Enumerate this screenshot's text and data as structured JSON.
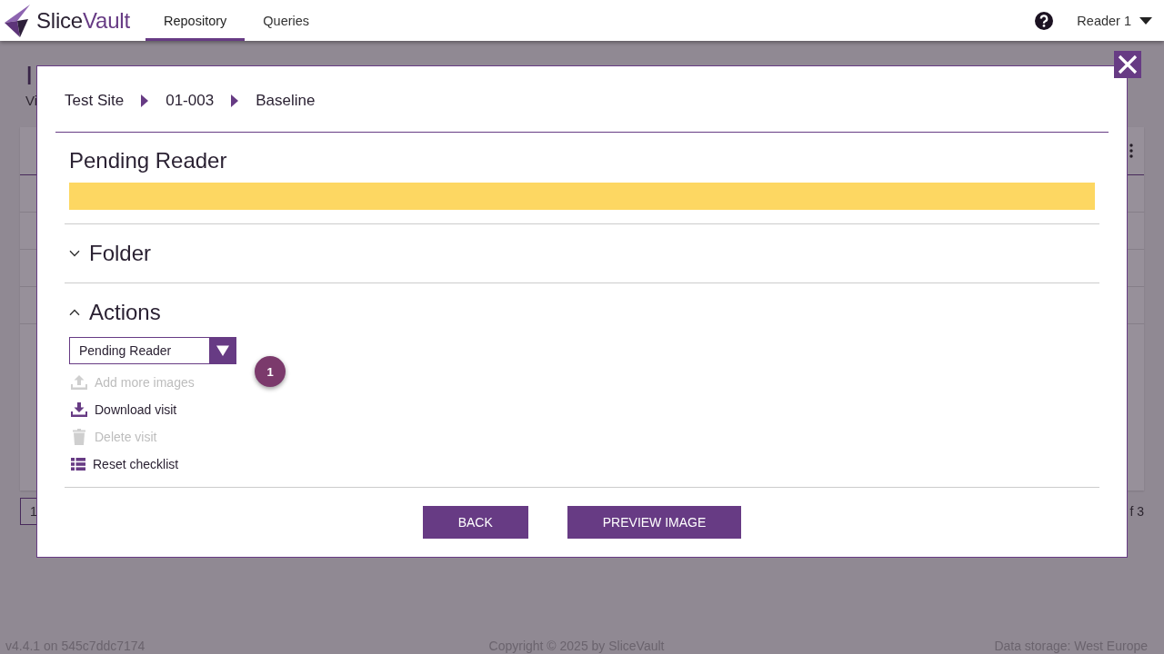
{
  "nav": {
    "logo": [
      "Slice",
      "Vault"
    ],
    "tabs": [
      {
        "label": "Repository",
        "selected": true
      },
      {
        "label": "Queries",
        "selected": false
      }
    ],
    "user": "Reader 1"
  },
  "background_page": {
    "heading": "I",
    "subtitle": "Vi",
    "page_button": "1",
    "page_count": "f 3"
  },
  "modal": {
    "breadcrumb": [
      "Test Site",
      "01-003",
      "Baseline"
    ],
    "status_title": "Pending Reader",
    "sections": [
      {
        "title": "Folder",
        "expanded": false
      },
      {
        "title": "Actions",
        "expanded": true,
        "select": {
          "value": "Pending Reader"
        },
        "badge": "1",
        "items": [
          {
            "label": "Add more images",
            "kind": "upload",
            "disabled": true
          },
          {
            "label": "Download visit",
            "kind": "download",
            "disabled": false
          },
          {
            "label": "Delete visit",
            "kind": "delete",
            "disabled": true
          },
          {
            "label": "Reset checklist",
            "kind": "list",
            "disabled": false
          }
        ]
      }
    ],
    "buttons": [
      "BACK",
      "PREVIEW IMAGE"
    ]
  },
  "footer": {
    "version": "v4.4.1 on 545c7ddc7174",
    "copyright": "Copyright © 2025 by SliceVault",
    "storage": "Data storage: West Europe"
  }
}
